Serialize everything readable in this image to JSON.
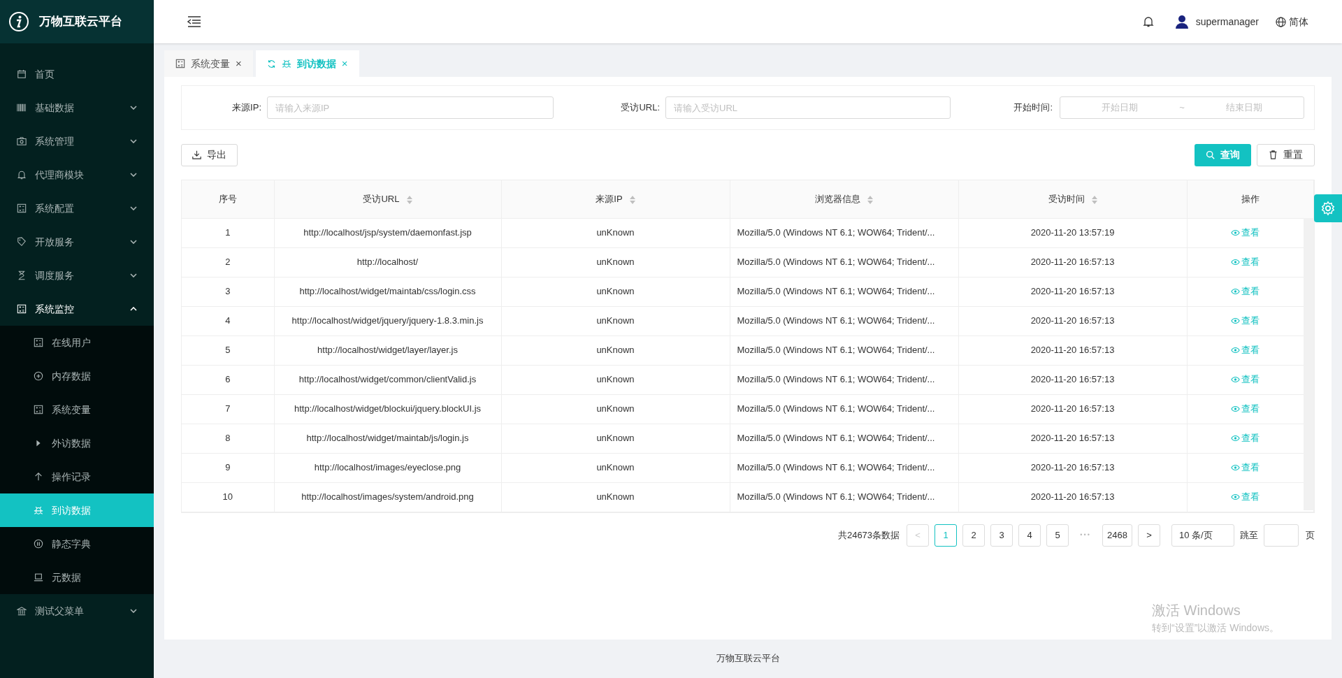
{
  "brand": {
    "title": "万物互联云平台"
  },
  "sidebar": {
    "items": [
      {
        "label": "首页",
        "kind": "calendar",
        "expanded": false,
        "has_children": false
      },
      {
        "label": "基础数据",
        "kind": "barcode",
        "expanded": false,
        "has_children": true
      },
      {
        "label": "系统管理",
        "kind": "camera",
        "expanded": false,
        "has_children": true
      },
      {
        "label": "代理商模块",
        "kind": "bell",
        "expanded": false,
        "has_children": true
      },
      {
        "label": "系统配置",
        "kind": "calc",
        "expanded": false,
        "has_children": true
      },
      {
        "label": "开放服务",
        "kind": "tag",
        "expanded": false,
        "has_children": true
      },
      {
        "label": "调度服务",
        "kind": "hourglass",
        "expanded": false,
        "has_children": true
      },
      {
        "label": "系统监控",
        "kind": "calc",
        "expanded": true,
        "has_children": true,
        "children": [
          {
            "label": "在线用户",
            "kind": "calc",
            "selected": false
          },
          {
            "label": "内存数据",
            "kind": "plus-circle",
            "selected": false
          },
          {
            "label": "系统变量",
            "kind": "calc",
            "selected": false
          },
          {
            "label": "外访数据",
            "kind": "play",
            "selected": false
          },
          {
            "label": "操作记录",
            "kind": "arrow-up",
            "selected": false
          },
          {
            "label": "到访数据",
            "kind": "bug",
            "selected": true
          },
          {
            "label": "静态字典",
            "kind": "pause-circle",
            "selected": false
          },
          {
            "label": "元数据",
            "kind": "laptop",
            "selected": false
          }
        ]
      },
      {
        "label": "测试父菜单",
        "kind": "bank",
        "expanded": false,
        "has_children": true
      }
    ]
  },
  "header": {
    "user": "supermanager",
    "language": "简体"
  },
  "tabs": [
    {
      "label": "系统变量",
      "kind": "calc",
      "selected": false,
      "close": "×"
    },
    {
      "label": "到访数据",
      "kind": "bug",
      "selected": true,
      "close": "×"
    }
  ],
  "filters": [
    {
      "label": "来源IP:",
      "placeholder": "请输入来源IP"
    },
    {
      "label": "受访URL:",
      "placeholder": "请输入受访URL"
    }
  ],
  "date_filter": {
    "label": "开始时间:",
    "start_placeholder": "开始日期",
    "separator": "~",
    "end_placeholder": "结束日期"
  },
  "toolbar": {
    "export": "导出",
    "query": "查询",
    "reset": "重置"
  },
  "table": {
    "columns": [
      {
        "label": "序号",
        "sortable": false
      },
      {
        "label": "受访URL",
        "sortable": true
      },
      {
        "label": "来源IP",
        "sortable": true
      },
      {
        "label": "浏览器信息",
        "sortable": true
      },
      {
        "label": "受访时间",
        "sortable": true
      },
      {
        "label": "操作",
        "sortable": false
      }
    ],
    "rows": [
      [
        "1",
        "http://localhost/jsp/system/daemonfast.jsp",
        "unKnown",
        "Mozilla/5.0 (Windows NT 6.1; WOW64; Trident/...",
        "2020-11-20 13:57:19",
        "查看"
      ],
      [
        "2",
        "http://localhost/",
        "unKnown",
        "Mozilla/5.0 (Windows NT 6.1; WOW64; Trident/...",
        "2020-11-20 16:57:13",
        "查看"
      ],
      [
        "3",
        "http://localhost/widget/maintab/css/login.css",
        "unKnown",
        "Mozilla/5.0 (Windows NT 6.1; WOW64; Trident/...",
        "2020-11-20 16:57:13",
        "查看"
      ],
      [
        "4",
        "http://localhost/widget/jquery/jquery-1.8.3.min.js",
        "unKnown",
        "Mozilla/5.0 (Windows NT 6.1; WOW64; Trident/...",
        "2020-11-20 16:57:13",
        "查看"
      ],
      [
        "5",
        "http://localhost/widget/layer/layer.js",
        "unKnown",
        "Mozilla/5.0 (Windows NT 6.1; WOW64; Trident/...",
        "2020-11-20 16:57:13",
        "查看"
      ],
      [
        "6",
        "http://localhost/widget/common/clientValid.js",
        "unKnown",
        "Mozilla/5.0 (Windows NT 6.1; WOW64; Trident/...",
        "2020-11-20 16:57:13",
        "查看"
      ],
      [
        "7",
        "http://localhost/widget/blockui/jquery.blockUI.js",
        "unKnown",
        "Mozilla/5.0 (Windows NT 6.1; WOW64; Trident/...",
        "2020-11-20 16:57:13",
        "查看"
      ],
      [
        "8",
        "http://localhost/widget/maintab/js/login.js",
        "unKnown",
        "Mozilla/5.0 (Windows NT 6.1; WOW64; Trident/...",
        "2020-11-20 16:57:13",
        "查看"
      ],
      [
        "9",
        "http://localhost/images/eyeclose.png",
        "unKnown",
        "Mozilla/5.0 (Windows NT 6.1; WOW64; Trident/...",
        "2020-11-20 16:57:13",
        "查看"
      ],
      [
        "10",
        "http://localhost/images/system/android.png",
        "unKnown",
        "Mozilla/5.0 (Windows NT 6.1; WOW64; Trident/...",
        "2020-11-20 16:57:13",
        "查看"
      ]
    ]
  },
  "pagination": {
    "total": "共24673条数据",
    "prev": "<",
    "pages": [
      {
        "label": "1",
        "selected": true
      },
      {
        "label": "2",
        "selected": false
      },
      {
        "label": "3",
        "selected": false
      },
      {
        "label": "4",
        "selected": false
      },
      {
        "label": "5",
        "selected": false
      }
    ],
    "ellipsis": "•••",
    "last": "2468",
    "next": ">",
    "page_size": "10 条/页",
    "jump_label": "跳至",
    "page_suffix": "页"
  },
  "os_notice": {
    "title": "激活 Windows",
    "text": "转到“设置”以激活 Windows。"
  },
  "footer": "万物互联云平台"
}
